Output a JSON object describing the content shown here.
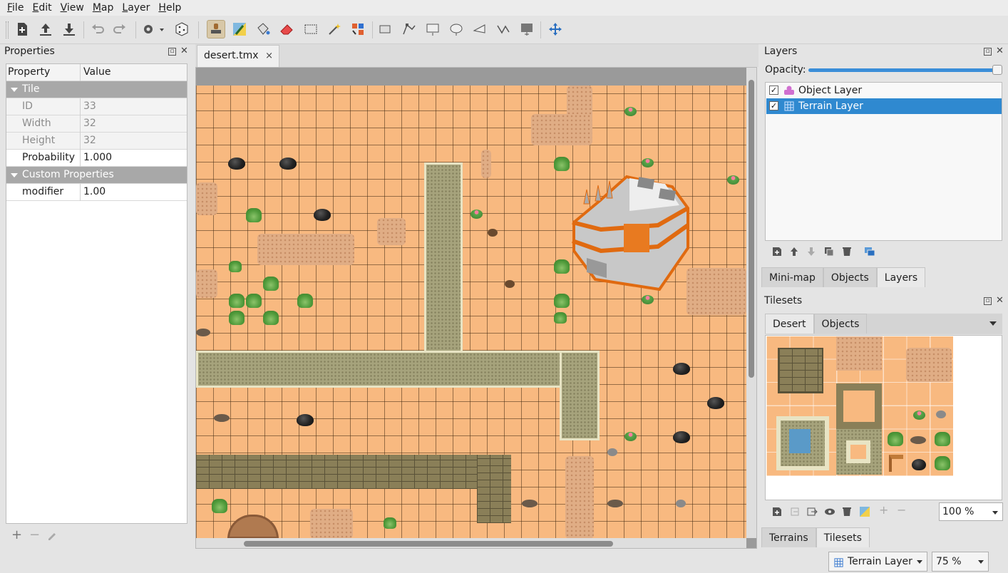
{
  "menu": [
    "File",
    "Edit",
    "View",
    "Map",
    "Layer",
    "Help"
  ],
  "toolbar": {
    "icons": [
      "new-map-icon",
      "open-icon",
      "save-icon",
      "undo-icon",
      "redo-icon",
      "commands-icon",
      "random-mode-icon",
      "stamp-brush-icon",
      "terrain-brush-icon",
      "bucket-fill-icon",
      "eraser-icon",
      "rectangular-select-icon",
      "magic-wand-icon",
      "select-same-tile-icon",
      "select-objects-icon",
      "edit-polygons-icon",
      "insert-rectangle-icon",
      "insert-ellipse-icon",
      "insert-polygon-icon",
      "insert-polyline-icon",
      "insert-tile-icon",
      "move-icon"
    ]
  },
  "properties": {
    "title": "Properties",
    "header": {
      "property": "Property",
      "value": "Value"
    },
    "groups": [
      {
        "name": "Tile",
        "rows": [
          {
            "name": "ID",
            "value": "33"
          },
          {
            "name": "Width",
            "value": "32"
          },
          {
            "name": "Height",
            "value": "32"
          },
          {
            "name": "Probability",
            "value": "1.000"
          }
        ]
      },
      {
        "name": "Custom Properties",
        "rows": [
          {
            "name": "modifier",
            "value": "1.00"
          }
        ]
      }
    ],
    "footer": {
      "add": "+",
      "remove": "−"
    }
  },
  "document": {
    "tab": "desert.tmx",
    "close": "×"
  },
  "layers": {
    "title": "Layers",
    "opacity_label": "Opacity:",
    "opacity": 1.0,
    "items": [
      {
        "name": "Object Layer",
        "visible": "✓",
        "selected": false
      },
      {
        "name": "Terrain Layer",
        "visible": "✓",
        "selected": true
      }
    ],
    "tabs": [
      "Mini-map",
      "Objects",
      "Layers"
    ],
    "active_tab": "Layers"
  },
  "tilesets": {
    "title": "Tilesets",
    "tabs": [
      "Desert",
      "Objects"
    ],
    "active_tab": "Desert",
    "zoom": "100 %"
  },
  "bottom_tabs": [
    "Terrains",
    "Tilesets"
  ],
  "status": {
    "layer": "Terrain Layer",
    "zoom": "75 %"
  },
  "colors": {
    "accent": "#2f89d0",
    "sand": "#f8b980",
    "road": "#a6a37c"
  }
}
